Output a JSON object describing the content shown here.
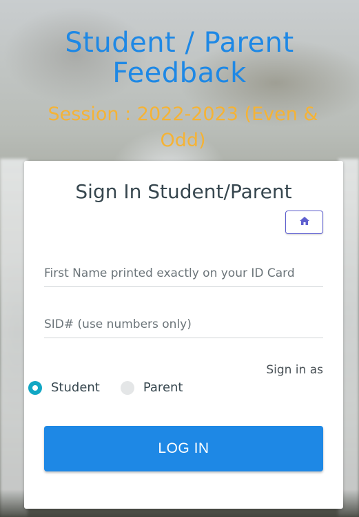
{
  "header": {
    "title_line1": "Student / Parent",
    "title_line2": "Feedback",
    "session_line1": "Session : 2022-2023 (Even &",
    "session_line2": "Odd)"
  },
  "card": {
    "title": "Sign In Student/Parent",
    "home_icon": "home-icon",
    "first_name_placeholder": "First Name printed exactly on your ID Card",
    "sid_placeholder": "SID# (use numbers only)",
    "sign_in_as_label": "Sign in as",
    "role_options": [
      {
        "label": "Student",
        "selected": true
      },
      {
        "label": "Parent",
        "selected": false
      }
    ],
    "login_label": "LOG IN"
  },
  "colors": {
    "title": "#1e88e5",
    "session": "#f5b335",
    "accent_radio": "#11a7c4",
    "login_button": "#1e88e5",
    "home_button_border": "#5e5fcf"
  }
}
